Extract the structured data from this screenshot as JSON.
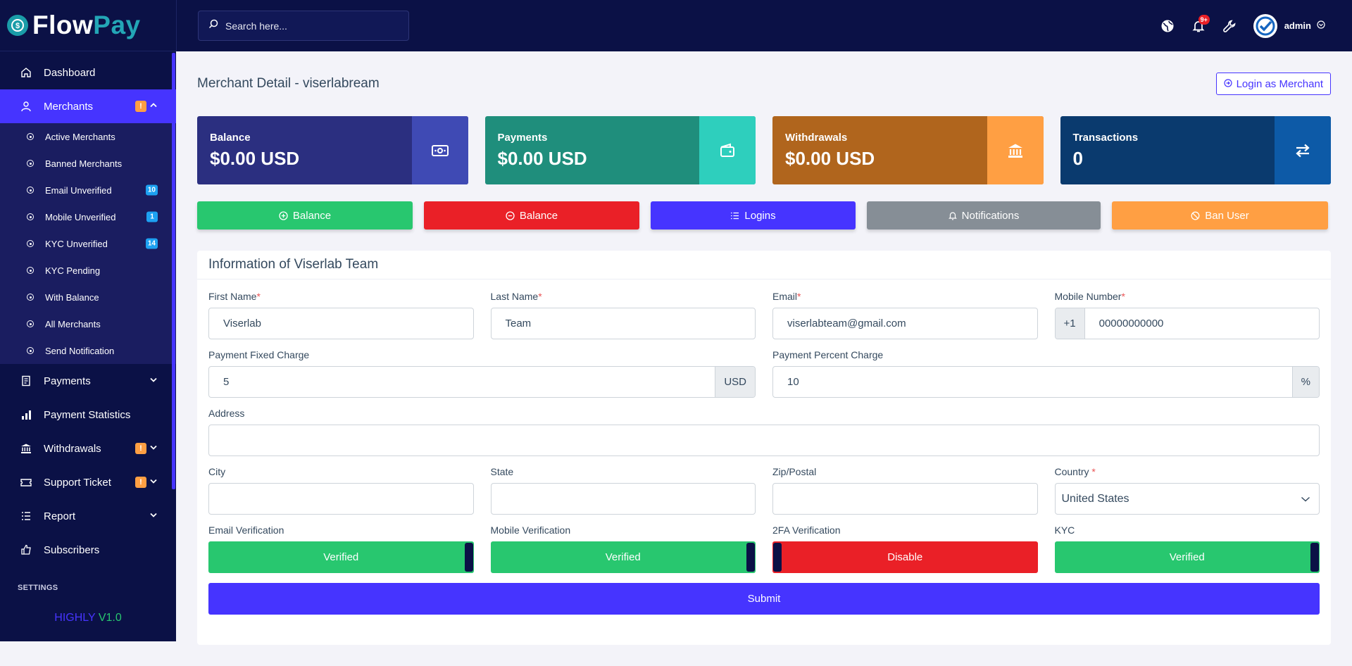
{
  "brand": {
    "part1": "Flow",
    "part2": "Pay"
  },
  "search": {
    "placeholder": "Search here..."
  },
  "header": {
    "notification_count": "9+",
    "user_name": "admin"
  },
  "sidebar": {
    "items": [
      {
        "label": "Dashboard",
        "icon": "home-icon"
      },
      {
        "label": "Merchants",
        "icon": "user-icon",
        "badge": "!"
      },
      {
        "label": "Payments",
        "icon": "receipt-icon"
      },
      {
        "label": "Payment Statistics",
        "icon": "bar-chart-icon"
      },
      {
        "label": "Withdrawals",
        "icon": "bank-icon",
        "badge": "!"
      },
      {
        "label": "Support Ticket",
        "icon": "ticket-icon",
        "badge": "!"
      },
      {
        "label": "Report",
        "icon": "list-icon"
      },
      {
        "label": "Subscribers",
        "icon": "thumbs-up-icon"
      }
    ],
    "submenu": [
      {
        "label": "Active Merchants"
      },
      {
        "label": "Banned Merchants"
      },
      {
        "label": "Email Unverified",
        "count": "10"
      },
      {
        "label": "Mobile Unverified",
        "count": "1"
      },
      {
        "label": "KYC Unverified",
        "count": "14"
      },
      {
        "label": "KYC Pending"
      },
      {
        "label": "With Balance"
      },
      {
        "label": "All Merchants"
      },
      {
        "label": "Send Notification"
      }
    ],
    "settings_title": "SETTINGS",
    "version_a": "HIGHLY",
    "version_b": "V1.0"
  },
  "page": {
    "title": "Merchant Detail - viserlabream",
    "login_button": "Login as Merchant"
  },
  "stats": [
    {
      "label": "Balance",
      "value": "$0.00 USD",
      "color": "#2b2f80",
      "icon_bg": "#3f4ab4",
      "icon": "money-icon"
    },
    {
      "label": "Payments",
      "value": "$0.00 USD",
      "color": "#1f8e7c",
      "icon_bg": "#2ecfbd",
      "icon": "wallet-icon"
    },
    {
      "label": "Withdrawals",
      "value": "$0.00 USD",
      "color": "#b0651d",
      "icon_bg": "#ff9f43",
      "icon": "bank-icon"
    },
    {
      "label": "Transactions",
      "value": "0",
      "color": "#0a3a6e",
      "icon_bg": "#0d5aa7",
      "icon": "exchange-icon"
    }
  ],
  "actions": [
    {
      "label": "Balance",
      "color": "#28c76f",
      "icon": "plus-circle-icon"
    },
    {
      "label": "Balance",
      "color": "#ea2027",
      "icon": "minus-circle-icon"
    },
    {
      "label": "Logins",
      "color": "#4634ff",
      "icon": "list-icon"
    },
    {
      "label": "Notifications",
      "color": "#868e96",
      "icon": "bell-icon"
    },
    {
      "label": "Ban User",
      "color": "#ff9f43",
      "icon": "ban-icon"
    }
  ],
  "form": {
    "title": "Information of Viserlab Team",
    "first_name_label": "First Name",
    "first_name": "Viserlab",
    "last_name_label": "Last Name",
    "last_name": "Team",
    "email_label": "Email",
    "email": "viserlabteam@gmail.com",
    "mobile_label": "Mobile Number",
    "mobile_code": "+1",
    "mobile": "00000000000",
    "fixed_charge_label": "Payment Fixed Charge",
    "fixed_charge": "5",
    "fixed_charge_unit": "USD",
    "percent_charge_label": "Payment Percent Charge",
    "percent_charge": "10",
    "percent_unit": "%",
    "address_label": "Address",
    "address": "",
    "city_label": "City",
    "city": "",
    "state_label": "State",
    "state": "",
    "zip_label": "Zip/Postal",
    "zip": "",
    "country_label": "Country",
    "country": "United States",
    "email_verification_label": "Email Verification",
    "email_verification": "Verified",
    "mobile_verification_label": "Mobile Verification",
    "mobile_verification": "Verified",
    "twofa_label": "2FA Verification",
    "twofa": "Disable",
    "kyc_label": "KYC",
    "kyc": "Verified",
    "submit": "Submit"
  }
}
